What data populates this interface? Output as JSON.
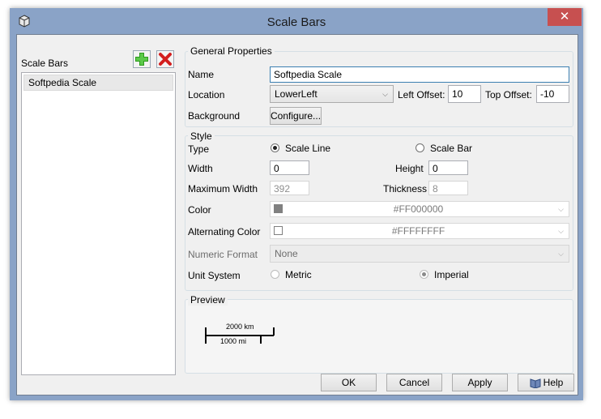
{
  "window": {
    "title": "Scale Bars",
    "close_glyph": "✕"
  },
  "sidebar": {
    "label": "Scale Bars",
    "add_icon": "plus-icon",
    "delete_icon": "delete-x-icon",
    "colors": {
      "add": "#2e9b1f",
      "delete": "#d31f1f"
    },
    "items": [
      {
        "label": "Softpedia Scale",
        "selected": true
      }
    ]
  },
  "general": {
    "title": "General Properties",
    "name_label": "Name",
    "name_value": "Softpedia Scale",
    "location_label": "Location",
    "location_value": "LowerLeft",
    "left_offset_label": "Left Offset:",
    "left_offset_value": "10",
    "top_offset_label": "Top Offset:",
    "top_offset_value": "-10",
    "background_label": "Background",
    "configure_label": "Configure..."
  },
  "style": {
    "title": "Style",
    "type_label": "Type",
    "type_options": [
      {
        "label": "Scale Line",
        "selected": true
      },
      {
        "label": "Scale Bar",
        "selected": false
      }
    ],
    "width_label": "Width",
    "width_value": "0",
    "height_label": "Height",
    "height_value": "0",
    "max_width_label": "Maximum Width",
    "max_width_value": "392",
    "thickness_label": "Thickness",
    "thickness_value": "8",
    "color_label": "Color",
    "color_value": "#FF000000",
    "color_swatch": "#808080",
    "alt_color_label": "Alternating Color",
    "alt_color_value": "#FFFFFFFF",
    "alt_color_swatch": "#ffffff",
    "numeric_format_label": "Numeric Format",
    "numeric_format_value": "None",
    "unit_system_label": "Unit System",
    "unit_options": [
      {
        "label": "Metric",
        "selected": false
      },
      {
        "label": "Imperial",
        "selected": true
      }
    ]
  },
  "preview": {
    "title": "Preview",
    "top_label": "2000 km",
    "bottom_label": "1000 mi"
  },
  "footer": {
    "ok_label": "OK",
    "cancel_label": "Cancel",
    "apply_label": "Apply",
    "help_label": "Help",
    "help_icon": "help-book-icon"
  }
}
